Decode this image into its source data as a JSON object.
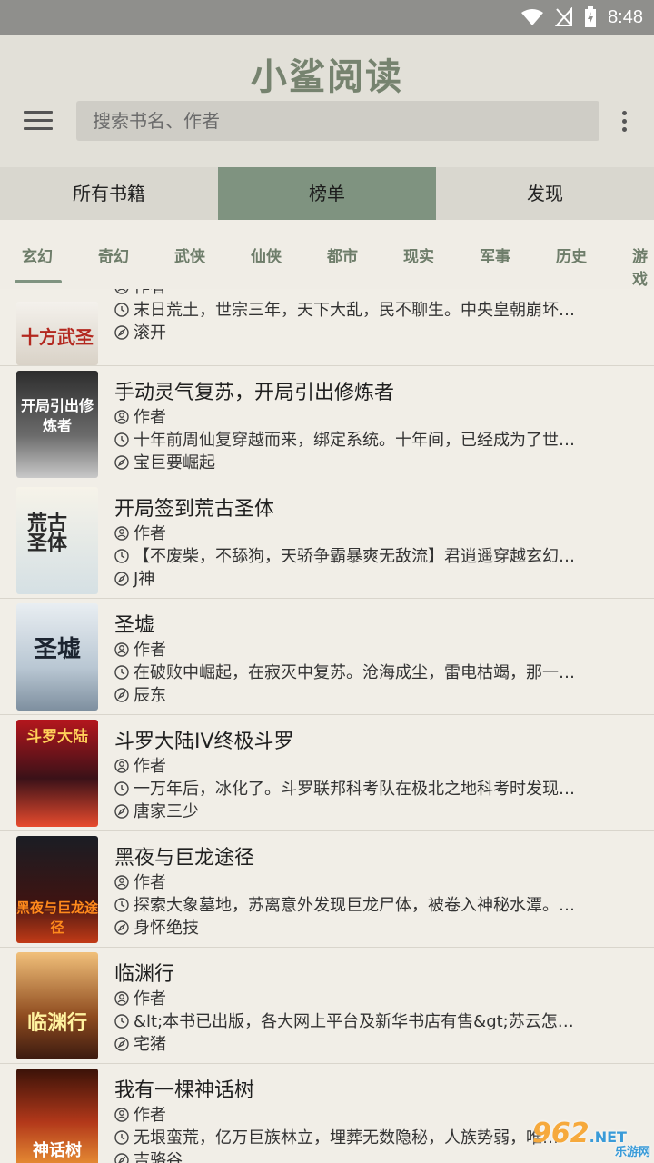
{
  "status": {
    "time": "8:48"
  },
  "app": {
    "title": "小鲨阅读"
  },
  "search": {
    "placeholder": "搜索书名、作者"
  },
  "main_tabs": [
    {
      "label": "所有书籍"
    },
    {
      "label": "榜单"
    },
    {
      "label": "发现"
    }
  ],
  "categories": [
    "玄幻",
    "奇幻",
    "武侠",
    "仙侠",
    "都市",
    "现实",
    "军事",
    "历史",
    "游戏"
  ],
  "books": [
    {
      "title": "",
      "author": "作者",
      "desc": "末日荒土，世宗三年，天下大乱，民不聊生。中央皇朝崩坏…",
      "latest": "滚开",
      "cover_text": "十方武圣"
    },
    {
      "title": "手动灵气复苏，开局引出修炼者",
      "author": "作者",
      "desc": "十年前周仙复穿越而来，绑定系统。十年间，已经成为了世…",
      "latest": "宝巨要崛起",
      "cover_text": "开局引出修炼者"
    },
    {
      "title": "开局签到荒古圣体",
      "author": "作者",
      "desc": "【不废柴，不舔狗，天骄争霸暴爽无敌流】君逍遥穿越玄幻…",
      "latest": "J神",
      "cover_text": "荒古圣体"
    },
    {
      "title": "圣墟",
      "author": "作者",
      "desc": "在破败中崛起，在寂灭中复苏。沧海成尘，雷电枯竭，那一…",
      "latest": "辰东",
      "cover_text": "圣墟"
    },
    {
      "title": "斗罗大陆IV终极斗罗",
      "author": "作者",
      "desc": "一万年后，冰化了。斗罗联邦科考队在极北之地科考时发现…",
      "latest": "唐家三少",
      "cover_text": "斗罗大陆"
    },
    {
      "title": "黑夜与巨龙途径",
      "author": "作者",
      "desc": "探索大象墓地，苏离意外发现巨龙尸体，被卷入神秘水潭。…",
      "latest": "身怀绝技",
      "cover_text": "黑夜与巨龙途径"
    },
    {
      "title": "临渊行",
      "author": "作者",
      "desc": "&lt;本书已出版，各大网上平台及新华书店有售&gt;苏云怎…",
      "latest": "宅猪",
      "cover_text": "临渊行"
    },
    {
      "title": "我有一棵神话树",
      "author": "作者",
      "desc": "无垠蛮荒，亿万巨族林立，埋葬无数隐秘，人族势弱，唯…",
      "latest": "吉骆谷",
      "cover_text": "神话树"
    }
  ],
  "watermark": {
    "text": "962",
    "suffix": ".NET",
    "sub": "乐游网"
  },
  "colors": {
    "accent": "#7f9380",
    "header": "#e2e0d8",
    "title": "#76836f"
  }
}
